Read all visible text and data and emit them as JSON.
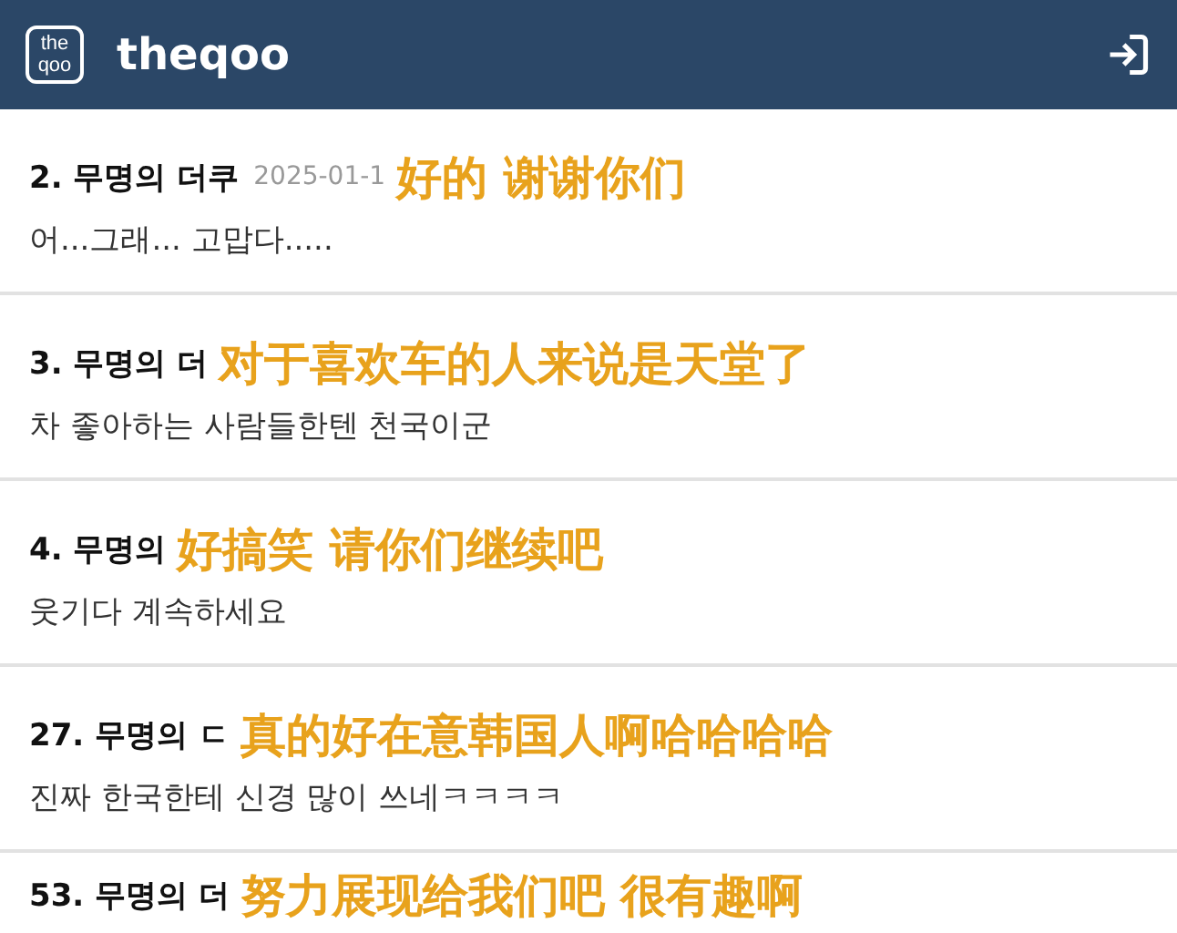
{
  "header": {
    "logo": [
      "the",
      "qoo"
    ],
    "title": "theqoo"
  },
  "comments": [
    {
      "author": "2. 무명의 더쿠",
      "date": "2025-01-1",
      "caption": "好的 谢谢你们",
      "body": "어...그래... 고맙다....."
    },
    {
      "author": "3. 무명의 더",
      "caption": "对于喜欢车的人来说是天堂了",
      "body": "차 좋아하는 사람들한텐 천국이군"
    },
    {
      "author": "4. 무명의",
      "caption": "好搞笑 请你们继续吧",
      "body": "웃기다 계속하세요"
    },
    {
      "author": "27. 무명의 ㄷ",
      "caption": "真的好在意韩国人啊哈哈哈哈",
      "body": "진짜 한국한테 신경 많이 쓰네ㅋㅋㅋㅋ"
    },
    {
      "author": "53. 무명의 더",
      "caption": "努力展现给我们吧 很有趣啊"
    }
  ]
}
